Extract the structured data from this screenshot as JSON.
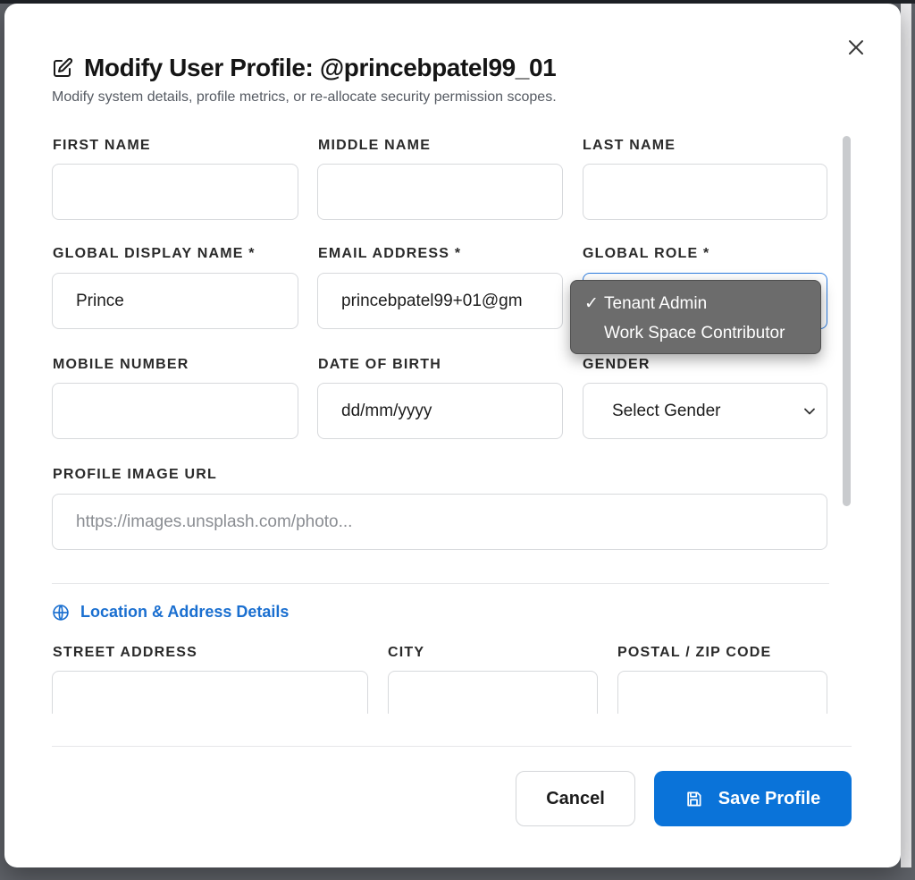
{
  "modal": {
    "title": "Modify User Profile: @princebpatel99_01",
    "subtitle": "Modify system details, profile metrics, or re-allocate security permission scopes."
  },
  "icons": {
    "title": "edit-icon",
    "close": "close-icon",
    "section": "globe-icon",
    "save": "save-icon",
    "select": "chevron-down-icon"
  },
  "fields": {
    "first_name": {
      "label": "FIRST NAME",
      "value": ""
    },
    "middle_name": {
      "label": "MIDDLE NAME",
      "value": ""
    },
    "last_name": {
      "label": "LAST NAME",
      "value": ""
    },
    "display_name": {
      "label": "GLOBAL DISPLAY NAME *",
      "value": "Prince"
    },
    "email": {
      "label": "EMAIL ADDRESS *",
      "value": "princebpatel99+01@gm"
    },
    "role": {
      "label": "GLOBAL ROLE *",
      "value": ""
    },
    "mobile": {
      "label": "MOBILE NUMBER",
      "value": ""
    },
    "dob": {
      "label": "DATE OF BIRTH",
      "value": "dd/mm/yyyy"
    },
    "gender": {
      "label": "GENDER",
      "value": "Select Gender"
    },
    "profile_image": {
      "label": "PROFILE IMAGE URL",
      "placeholder": "https://images.unsplash.com/photo..."
    },
    "street": {
      "label": "STREET ADDRESS",
      "value": ""
    },
    "city": {
      "label": "CITY",
      "value": ""
    },
    "postal": {
      "label": "POSTAL / ZIP CODE",
      "value": ""
    }
  },
  "location_section": {
    "title": "Location & Address Details"
  },
  "role_dropdown": {
    "check": "✓",
    "options": [
      {
        "label": "Tenant Admin",
        "selected": true
      },
      {
        "label": "Work Space Contributor",
        "selected": false
      }
    ]
  },
  "footer": {
    "cancel": "Cancel",
    "save": "Save Profile"
  },
  "colors": {
    "accent": "#0a73d9",
    "section_title": "#1a6fd0",
    "dropdown_bg": "#6c6c6c"
  }
}
